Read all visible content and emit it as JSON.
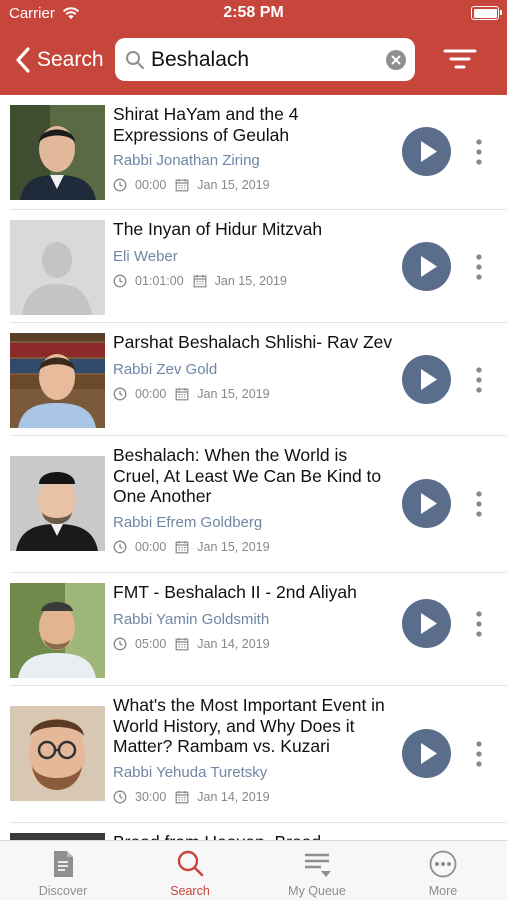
{
  "status_bar": {
    "carrier": "Carrier",
    "time": "2:58 PM"
  },
  "nav": {
    "back_label": "Search"
  },
  "search": {
    "value": "Beshalach",
    "placeholder": "Search"
  },
  "results": [
    {
      "title": "Shirat HaYam and the 4 Expressions of Geulah",
      "speaker": "Rabbi Jonathan Ziring",
      "duration": "00:00",
      "date": "Jan 15, 2019"
    },
    {
      "title": "The Inyan of Hidur Mitzvah",
      "speaker": "Eli Weber",
      "duration": "01:01:00",
      "date": "Jan 15, 2019"
    },
    {
      "title": "Parshat Beshalach Shlishi- Rav Zev",
      "speaker": "Rabbi Zev Gold",
      "duration": "00:00",
      "date": "Jan 15, 2019"
    },
    {
      "title": "Beshalach: When the World is Cruel, At Least We Can Be Kind to One Another",
      "speaker": "Rabbi Efrem Goldberg",
      "duration": "00:00",
      "date": "Jan 15, 2019"
    },
    {
      "title": "FMT - Beshalach II - 2nd Aliyah",
      "speaker": "Rabbi Yamin Goldsmith",
      "duration": "05:00",
      "date": "Jan 14, 2019"
    },
    {
      "title": "What's the Most Important Event in World History, and Why Does it Matter? Rambam vs. Kuzari",
      "speaker": "Rabbi Yehuda Turetsky",
      "duration": "30:00",
      "date": "Jan 14, 2019"
    },
    {
      "title": "Bread from Heaven, Bread",
      "speaker": "",
      "duration": "",
      "date": ""
    }
  ],
  "tabs": [
    {
      "label": "Discover",
      "icon": "document-icon"
    },
    {
      "label": "Search",
      "icon": "search-icon"
    },
    {
      "label": "My Queue",
      "icon": "queue-icon"
    },
    {
      "label": "More",
      "icon": "more-icon"
    }
  ],
  "colors": {
    "header": "#c6463c",
    "play_button": "#5a6e8c",
    "speaker_text": "#6f86a5",
    "active_tab": "#c6463c"
  }
}
